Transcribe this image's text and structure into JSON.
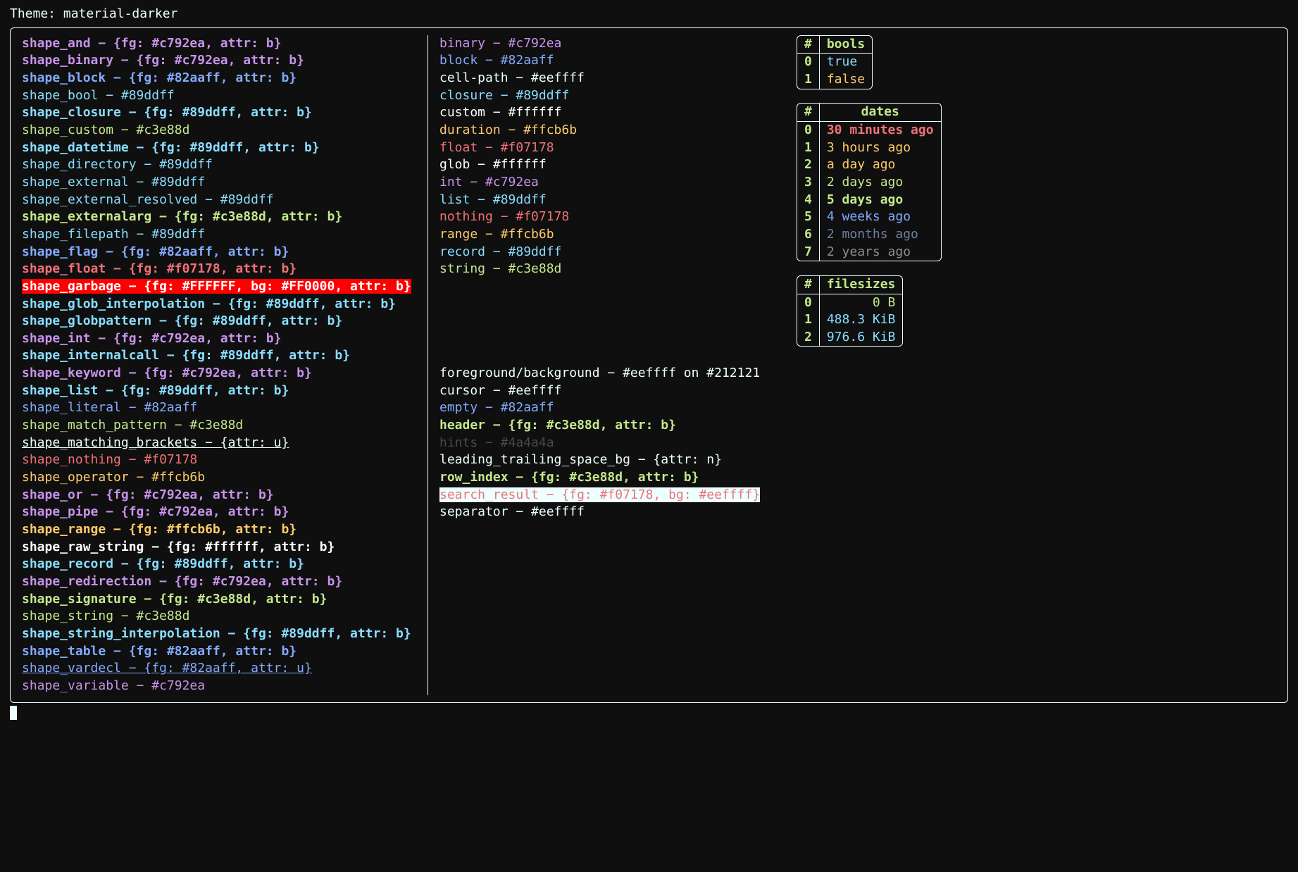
{
  "theme_label": "Theme:",
  "theme_name": "material-darker",
  "colors": {
    "fg": "#eeffff",
    "bg": "#212121",
    "purple": "#c792ea",
    "blue": "#82aaff",
    "cyan": "#89ddff",
    "green": "#c3e88d",
    "red": "#f07178",
    "yellow": "#ffcb6b",
    "white": "#ffffff",
    "pink": "#d95d86",
    "slate": "#6d7fa1",
    "gray": "#8d8d8d",
    "hint": "#4a4a4a",
    "err_bg": "#FF0000"
  },
  "shapes": [
    {
      "name": "shape_and",
      "fg": "#c792ea",
      "attr": "b"
    },
    {
      "name": "shape_binary",
      "fg": "#c792ea",
      "attr": "b"
    },
    {
      "name": "shape_block",
      "fg": "#82aaff",
      "attr": "b"
    },
    {
      "name": "shape_bool",
      "color": "#89ddff"
    },
    {
      "name": "shape_closure",
      "fg": "#89ddff",
      "attr": "b"
    },
    {
      "name": "shape_custom",
      "color": "#c3e88d"
    },
    {
      "name": "shape_datetime",
      "fg": "#89ddff",
      "attr": "b"
    },
    {
      "name": "shape_directory",
      "color": "#89ddff"
    },
    {
      "name": "shape_external",
      "color": "#89ddff"
    },
    {
      "name": "shape_external_resolved",
      "color": "#89ddff"
    },
    {
      "name": "shape_externalarg",
      "fg": "#c3e88d",
      "attr": "b"
    },
    {
      "name": "shape_filepath",
      "color": "#89ddff"
    },
    {
      "name": "shape_flag",
      "fg": "#82aaff",
      "attr": "b"
    },
    {
      "name": "shape_float",
      "fg": "#f07178",
      "attr": "b"
    },
    {
      "name": "shape_garbage",
      "fg": "#FFFFFF",
      "bg": "#FF0000",
      "attr": "b"
    },
    {
      "name": "shape_glob_interpolation",
      "fg": "#89ddff",
      "attr": "b"
    },
    {
      "name": "shape_globpattern",
      "fg": "#89ddff",
      "attr": "b"
    },
    {
      "name": "shape_int",
      "fg": "#c792ea",
      "attr": "b"
    },
    {
      "name": "shape_internalcall",
      "fg": "#89ddff",
      "attr": "b"
    },
    {
      "name": "shape_keyword",
      "fg": "#c792ea",
      "attr": "b"
    },
    {
      "name": "shape_list",
      "fg": "#89ddff",
      "attr": "b"
    },
    {
      "name": "shape_literal",
      "color": "#82aaff"
    },
    {
      "name": "shape_match_pattern",
      "color": "#c3e88d"
    },
    {
      "name": "shape_matching_brackets",
      "attr": "u"
    },
    {
      "name": "shape_nothing",
      "color": "#f07178"
    },
    {
      "name": "shape_operator",
      "color": "#ffcb6b"
    },
    {
      "name": "shape_or",
      "fg": "#c792ea",
      "attr": "b"
    },
    {
      "name": "shape_pipe",
      "fg": "#c792ea",
      "attr": "b"
    },
    {
      "name": "shape_range",
      "fg": "#ffcb6b",
      "attr": "b"
    },
    {
      "name": "shape_raw_string",
      "fg": "#ffffff",
      "attr": "b"
    },
    {
      "name": "shape_record",
      "fg": "#89ddff",
      "attr": "b"
    },
    {
      "name": "shape_redirection",
      "fg": "#c792ea",
      "attr": "b"
    },
    {
      "name": "shape_signature",
      "fg": "#c3e88d",
      "attr": "b"
    },
    {
      "name": "shape_string",
      "color": "#c3e88d"
    },
    {
      "name": "shape_string_interpolation",
      "fg": "#89ddff",
      "attr": "b"
    },
    {
      "name": "shape_table",
      "fg": "#82aaff",
      "attr": "b"
    },
    {
      "name": "shape_vardecl",
      "fg": "#82aaff",
      "attr": "u"
    },
    {
      "name": "shape_variable",
      "color": "#c792ea"
    }
  ],
  "types": [
    {
      "name": "binary",
      "color": "#c792ea"
    },
    {
      "name": "block",
      "color": "#82aaff"
    },
    {
      "name": "cell-path",
      "color": "#eeffff"
    },
    {
      "name": "closure",
      "color": "#89ddff"
    },
    {
      "name": "custom",
      "color": "#ffffff"
    },
    {
      "name": "duration",
      "color": "#ffcb6b"
    },
    {
      "name": "float",
      "color": "#f07178"
    },
    {
      "name": "glob",
      "color": "#ffffff"
    },
    {
      "name": "int",
      "color": "#c792ea"
    },
    {
      "name": "list",
      "color": "#89ddff"
    },
    {
      "name": "nothing",
      "color": "#f07178"
    },
    {
      "name": "range",
      "color": "#ffcb6b"
    },
    {
      "name": "record",
      "color": "#89ddff"
    },
    {
      "name": "string",
      "color": "#c3e88d"
    }
  ],
  "other": [
    {
      "raw": "foreground/background − #eeffff on #212121",
      "color": "#eeffff"
    },
    {
      "raw": "cursor − #eeffff",
      "color": "#eeffff"
    },
    {
      "name": "empty",
      "color": "#82aaff"
    },
    {
      "name": "header",
      "fg": "#c3e88d",
      "attr": "b"
    },
    {
      "name": "hints",
      "color": "#4a4a4a",
      "dim": true
    },
    {
      "name": "leading_trailing_space_bg",
      "attr": "n"
    },
    {
      "name": "row_index",
      "fg": "#c3e88d",
      "attr": "b"
    },
    {
      "name": "search_result",
      "fg": "#f07178",
      "bg": "#eeffff"
    },
    {
      "name": "separator",
      "color": "#eeffff"
    }
  ],
  "tables": {
    "bools": {
      "headers": [
        "#",
        "bools"
      ],
      "rows": [
        {
          "i": "0",
          "v": "true",
          "c": "#89ddff"
        },
        {
          "i": "1",
          "v": "false",
          "c": "#ffcb6b"
        }
      ]
    },
    "dates": {
      "headers": [
        "#",
        "dates"
      ],
      "rows": [
        {
          "i": "0",
          "v": "30 minutes ago",
          "c": "#f07178",
          "b": true
        },
        {
          "i": "1",
          "v": "3 hours ago",
          "c": "#ffcb6b"
        },
        {
          "i": "2",
          "v": "a day ago",
          "c": "#ffcb6b"
        },
        {
          "i": "3",
          "v": "2 days ago",
          "c": "#c3e88d"
        },
        {
          "i": "4",
          "v": "5 days ago",
          "c": "#c3e88d",
          "b": true
        },
        {
          "i": "5",
          "v": "4 weeks ago",
          "c": "#82aaff"
        },
        {
          "i": "6",
          "v": "2 months ago",
          "c": "#6d7fa1"
        },
        {
          "i": "7",
          "v": "2 years ago",
          "c": "#8d8d8d"
        }
      ]
    },
    "filesizes": {
      "headers": [
        "#",
        "filesizes"
      ],
      "rows": [
        {
          "i": "0",
          "v": "0 B",
          "c": "#c3e88d",
          "align": "right"
        },
        {
          "i": "1",
          "v": "488.3 KiB",
          "c": "#89ddff",
          "align": "right"
        },
        {
          "i": "2",
          "v": "976.6 KiB",
          "c": "#89ddff",
          "align": "right"
        }
      ]
    }
  }
}
